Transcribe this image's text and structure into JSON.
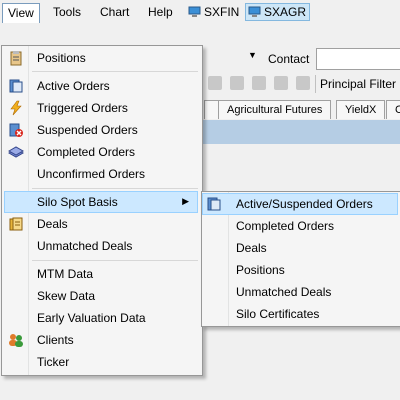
{
  "menubar": {
    "items": [
      "View",
      "Tools",
      "Chart",
      "Help"
    ],
    "tabs": [
      "SXFIN",
      "SXAGR"
    ]
  },
  "background": {
    "contact_label": "Contact",
    "principal_filter": "Principal Filter",
    "tabs": [
      "Agricultural Futures",
      "YieldX",
      "C"
    ]
  },
  "view_menu": {
    "items": [
      "Positions",
      "Active Orders",
      "Triggered Orders",
      "Suspended Orders",
      "Completed Orders",
      "Unconfirmed Orders",
      "Silo Spot Basis",
      "Deals",
      "Unmatched Deals",
      "MTM Data",
      "Skew Data",
      "Early Valuation Data",
      "Clients",
      "Ticker"
    ]
  },
  "submenu": {
    "items": [
      "Active/Suspended Orders",
      "Completed Orders",
      "Deals",
      "Positions",
      "Unmatched Deals",
      "Silo Certificates"
    ]
  },
  "colors": {
    "highlight": "#cce8ff",
    "highlight_border": "#99d1ff",
    "header_band": "#b5cde4"
  }
}
